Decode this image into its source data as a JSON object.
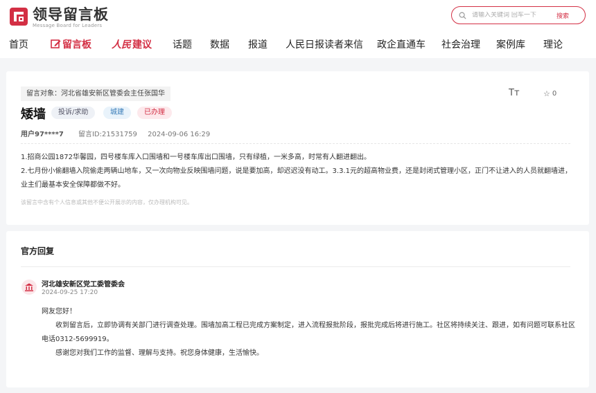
{
  "logo": {
    "title": "领导留言板",
    "subtitle": "Message Board for Leaders"
  },
  "search": {
    "placeholder": "请输入关键词 回车一下",
    "button_label": "搜索"
  },
  "nav": {
    "items": [
      {
        "label": "首页"
      },
      {
        "label": "留言板",
        "active": true
      },
      {
        "label": "建议",
        "brand": "人民"
      },
      {
        "label": "话题"
      },
      {
        "label": "数据"
      },
      {
        "label": "报道"
      },
      {
        "label": "人民日报读者来信"
      },
      {
        "label": "政企直通车"
      },
      {
        "label": "社会治理"
      },
      {
        "label": "案例库"
      },
      {
        "label": "理论"
      }
    ]
  },
  "message": {
    "target": "留言对象：河北省雄安新区管委会主任张国华",
    "font_toggle": "Tт",
    "favorites": "0",
    "title": "矮墙",
    "tags": [
      "投诉/求助",
      "城建",
      "已办理"
    ],
    "user": "用户97****7",
    "message_id": "留言ID:21531759",
    "datetime": "2024-09-06 16:29",
    "content": [
      "1.招商公园1872华馨园，四号楼车库入口围墙和一号楼车库出口围墙，只有绿植，一米多高，时常有人翻进翻出。",
      "2.七月份小偷翻墙入院偷走两辆山地车，又一次向物业反映围墙问题，说是要加高，却迟迟没有动工。3.3.1元的超高物业费，还是封闭式管理小区，正门不让进入的人员就翻墙进，",
      "业主们最基本安全保障都做不好。"
    ],
    "privacy_note": "该留言中含有个人信息或其他不便公开展示的内容，仅办理机构可见。"
  },
  "reply": {
    "heading": "官方回复",
    "org_name": "河北雄安新区党工委管委会",
    "datetime": "2024-09-25 17:20",
    "greeting": "网友您好！",
    "paragraph1": "收到留言后，立即协调有关部门进行调查处理。围墙加高工程已完成方案制定，进入流程报批阶段，报批完成后将进行施工。社区将持续关注、跟进，如有问题可联系社区电话0312-5699919。",
    "paragraph2": "感谢您对我们工作的监督、理解与支持。祝您身体健康，生活愉快。"
  },
  "colors": {
    "brand": "#d32f44",
    "page_bg": "#f4f5f7"
  }
}
